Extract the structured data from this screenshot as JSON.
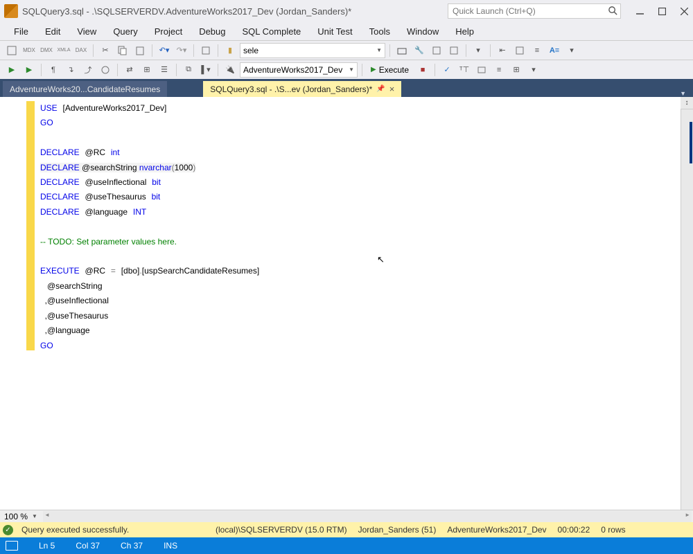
{
  "title": "SQLQuery3.sql - .\\SQLSERVERDV.AdventureWorks2017_Dev (Jordan_Sanders)*",
  "quicklaunch_placeholder": "Quick Launch (Ctrl+Q)",
  "menu": [
    "File",
    "Edit",
    "View",
    "Query",
    "Project",
    "Debug",
    "SQL Complete",
    "Unit Test",
    "Tools",
    "Window",
    "Help"
  ],
  "toolbar_combo": "sele",
  "db_combo": "AdventureWorks2017_Dev",
  "execute_label": "Execute",
  "tabs": {
    "inactive": "AdventureWorks20...CandidateResumes",
    "active": "SQLQuery3.sql - .\\S...ev (Jordan_Sanders)*"
  },
  "zoom": "100 %",
  "status": {
    "msg": "Query executed successfully.",
    "server": "(local)\\SQLSERVERDV (15.0 RTM)",
    "user": "Jordan_Sanders (51)",
    "db": "AdventureWorks2017_Dev",
    "elapsed": "00:00:22",
    "rows": "0 rows"
  },
  "bottom": {
    "ln": "Ln 5",
    "col": "Col 37",
    "ch": "Ch 37",
    "ins": "INS"
  },
  "code": {
    "l1a": "USE",
    "l1b": "[AdventureWorks2017_Dev]",
    "l2": "GO",
    "l4a": "DECLARE",
    "l4b": "@RC",
    "l4c": "int",
    "l5a": "DECLARE",
    "l5b": "@searchString",
    "l5c": "nvarchar",
    "l5d": "(",
    "l5e": "1000",
    "l5f": ")",
    "l6a": "DECLARE",
    "l6b": "@useInflectional",
    "l6c": "bit",
    "l7a": "DECLARE",
    "l7b": "@useThesaurus",
    "l7c": "bit",
    "l8a": "DECLARE",
    "l8b": "@language",
    "l8c": "INT",
    "l10": "-- TODO: Set parameter values here.",
    "l12a": "EXECUTE",
    "l12b": "@RC",
    "l12c": "=",
    "l12d": "[dbo]",
    "l12e": ".",
    "l12f": "[uspSearchCandidateResumes]",
    "l13": "   @searchString",
    "l14": "  ,@useInflectional",
    "l15": "  ,@useThesaurus",
    "l16": "  ,@language",
    "l17": "GO"
  }
}
